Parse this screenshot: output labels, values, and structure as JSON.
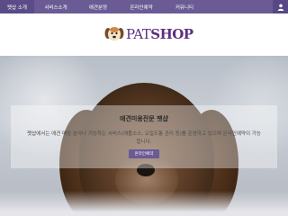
{
  "nav": {
    "items": [
      {
        "label": "팻샵 소개",
        "active": true
      },
      {
        "label": "서비스소개",
        "active": false
      },
      {
        "label": "애견분양",
        "active": false
      },
      {
        "label": "온라인예약",
        "active": false
      },
      {
        "label": "커뮤니티",
        "active": false
      }
    ],
    "user_icon": "user-icon"
  },
  "logo": {
    "icon": "dog-face-icon",
    "text_part1": "PAT",
    "text_part2": "SHOP"
  },
  "hero": {
    "title": "애견미용전문 팻샵",
    "description": "팻샵에서는 애견 매장 분야나 기능하는 서비스(애플소스, 오일도통 관리 등)를 운영하고 있으며 온라인예약이 가능합니다.",
    "button_label": "온라인예약"
  },
  "colors": {
    "nav_bg": "#6a5b95",
    "nav_active": "#5b4b86",
    "brand": "#5c2f7f",
    "button_bg": "#6a5b95"
  }
}
